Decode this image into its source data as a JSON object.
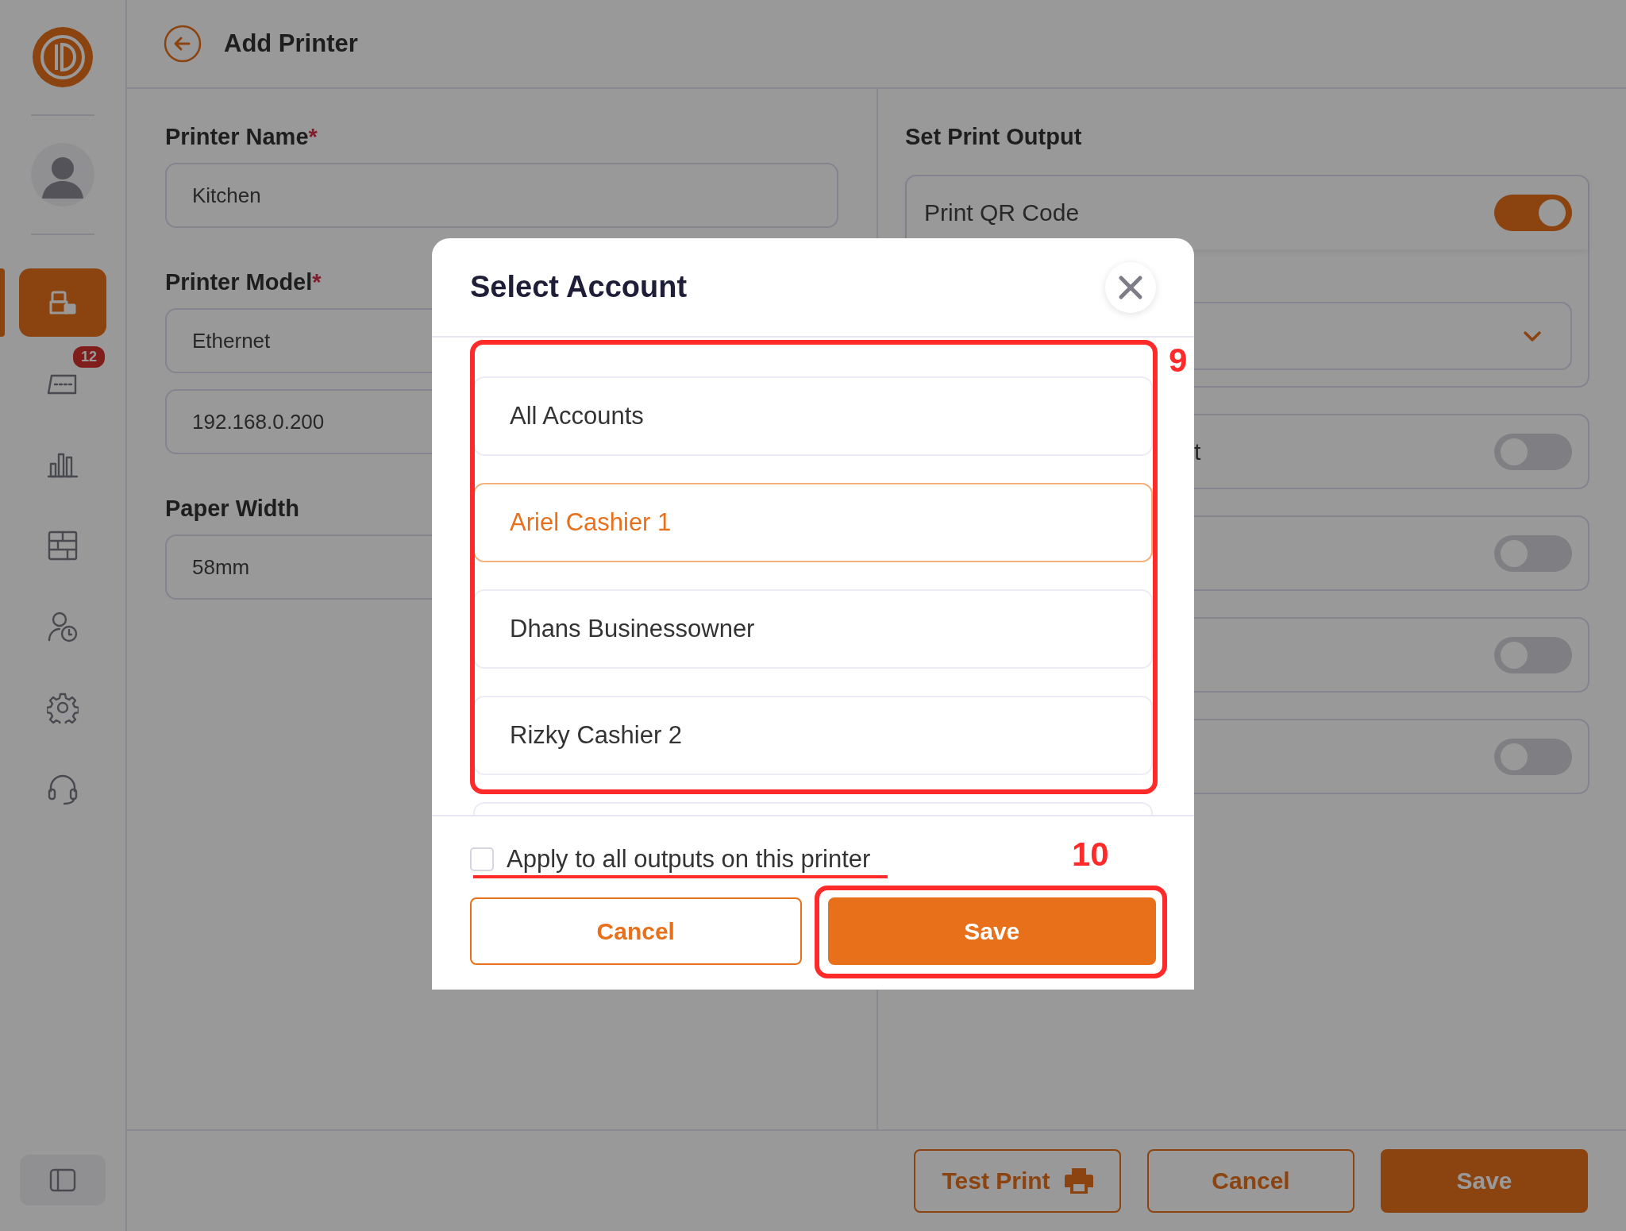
{
  "sidebar": {
    "items": [
      {
        "kind": "printer",
        "selected": true
      },
      {
        "kind": "cashier",
        "selected": false,
        "badge": "12"
      },
      {
        "kind": "chart",
        "selected": false
      },
      {
        "kind": "storage",
        "selected": false
      },
      {
        "kind": "staff",
        "selected": false
      },
      {
        "kind": "settings",
        "selected": false
      },
      {
        "kind": "support",
        "selected": false
      }
    ]
  },
  "header": {
    "title": "Add Printer"
  },
  "form": {
    "fields": [
      {
        "label": "Printer Name",
        "required_mark": "*",
        "value": "Kitchen"
      },
      {
        "label": "Printer Model",
        "required_mark": "*",
        "value": "Ethernet"
      },
      {
        "value": "192.168.0.200"
      },
      {
        "label": "Paper Width",
        "value": "58mm"
      }
    ]
  },
  "output": {
    "title": "Set Print Output",
    "rows": [
      {
        "kind": "toggle",
        "label": "Print QR Code",
        "on": true
      },
      {
        "kind": "select"
      },
      {
        "kind": "toggle",
        "label": "t",
        "on": false
      },
      {
        "kind": "toggle",
        "on": false
      },
      {
        "kind": "toggle",
        "on": false
      },
      {
        "kind": "toggle",
        "on": false
      }
    ]
  },
  "footer": {
    "buttons": [
      {
        "label": "Test Print",
        "kind": "print"
      },
      {
        "label": "Cancel",
        "kind": "secondary"
      },
      {
        "label": "Save",
        "kind": "primary"
      }
    ]
  },
  "modal": {
    "title": "Select Account",
    "items": [
      {
        "label": "All Accounts",
        "selected": false
      },
      {
        "label": "Ariel Cashier 1",
        "selected": true
      },
      {
        "label": "Dhans Businessowner",
        "selected": false
      },
      {
        "label": "Rizky Cashier 2",
        "selected": false
      }
    ],
    "checkbox": {
      "label": "Apply to all outputs on this printer",
      "checked": false
    },
    "buttons": [
      {
        "label": "Cancel",
        "kind": "secondary"
      },
      {
        "label": "Save",
        "kind": "primary"
      }
    ]
  },
  "annotations": [
    {
      "kind": "box",
      "label": "9"
    },
    {
      "kind": "box",
      "label": "10"
    },
    {
      "kind": "underline"
    }
  ]
}
